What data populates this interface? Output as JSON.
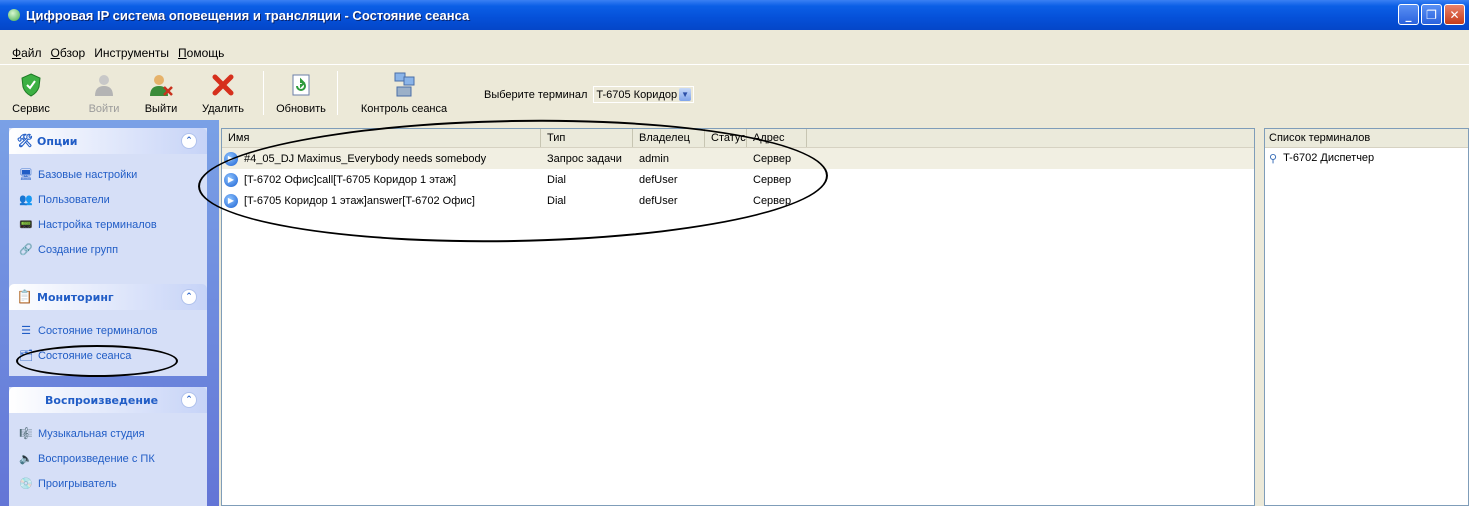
{
  "window": {
    "title": "Цифровая IP система оповещения и трансляции  -  Состояние сеанса",
    "min_glyph": "_",
    "max_glyph": "❐",
    "close_glyph": "✕"
  },
  "menu": [
    {
      "hot": "Ф",
      "rest": "айл"
    },
    {
      "hot": "О",
      "rest": "бзор"
    },
    {
      "hot": "",
      "rest": "Инструменты"
    },
    {
      "hot": "П",
      "rest": "омощь"
    }
  ],
  "toolbar": {
    "service": "Сервис",
    "login": "Войти",
    "logout": "Выйти",
    "delete": "Удалить",
    "refresh": "Обновить",
    "session_control": "Контроль сеанса",
    "select_terminal_label": "Выберите терминал",
    "selected_terminal": "T-6705 Коридор"
  },
  "sidebar": {
    "options": {
      "title": "Опции",
      "items": [
        {
          "label": "Базовые настройки",
          "icon": "monitor-icon"
        },
        {
          "label": "Пользователи",
          "icon": "users-icon"
        },
        {
          "label": "Настройка терминалов",
          "icon": "terminal-icon"
        },
        {
          "label": "Создание групп",
          "icon": "groups-icon"
        }
      ]
    },
    "monitoring": {
      "title": "Мониторинг",
      "items": [
        {
          "label": "Состояние терминалов",
          "icon": "list-icon"
        },
        {
          "label": "Состояние сеанса",
          "icon": "session-icon"
        }
      ]
    },
    "playback": {
      "title": "Воспроизведение",
      "items": [
        {
          "label": "Музыкальная студия",
          "icon": "studio-icon"
        },
        {
          "label": "Воспроизведение с ПК",
          "icon": "speaker-icon"
        },
        {
          "label": "Проигрыватель",
          "icon": "player-icon"
        }
      ]
    }
  },
  "list": {
    "columns": [
      "Имя",
      "Тип",
      "Владелец",
      "Статус",
      "Адрес"
    ],
    "rows": [
      {
        "name": "#4_05_DJ Maximus_Everybody needs somebody",
        "type": "Запрос задачи",
        "owner": "admin",
        "status": "",
        "address": "Сервер"
      },
      {
        "name": "[T-6702 Офис]call[T-6705 Коридор 1 этаж]",
        "type": "Dial",
        "owner": "defUser",
        "status": "",
        "address": "Сервер"
      },
      {
        "name": "[T-6705 Коридор 1 этаж]answer[T-6702 Офис]",
        "type": "Dial",
        "owner": "defUser",
        "status": "",
        "address": "Сервер"
      }
    ]
  },
  "terminals": {
    "header": "Список терминалов",
    "items": [
      "T-6702 Диспетчер"
    ]
  }
}
